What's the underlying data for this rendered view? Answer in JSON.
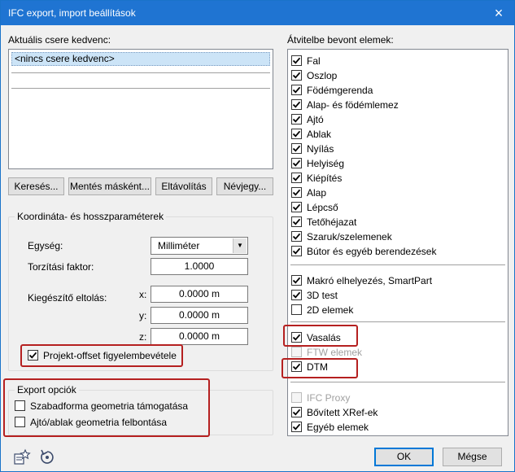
{
  "window": {
    "title": "IFC export, import beállítások",
    "close_icon": "×"
  },
  "favorites": {
    "label": "Aktuális csere kedvenc:",
    "items": [
      "<nincs csere kedvenc>"
    ]
  },
  "fav_buttons": {
    "search": "Keresés...",
    "save_as": "Mentés másként...",
    "remove": "Eltávolítás",
    "info": "Névjegy..."
  },
  "coords": {
    "group_title": "Koordináta- és hosszparaméterek",
    "unit_label": "Egység:",
    "unit_value": "Milliméter",
    "distortion_label": "Torzítási faktor:",
    "distortion_value": "1.0000",
    "offset_label": "Kiegészítő eltolás:",
    "x_label": "x:",
    "x_value": "0.0000 m",
    "y_label": "y:",
    "y_value": "0.0000 m",
    "z_label": "z:",
    "z_value": "0.0000 m",
    "project_offset_label": "Projekt-offset figyelembevétele",
    "project_offset_checked": true
  },
  "export_options": {
    "group_title": "Export opciók",
    "items": [
      {
        "label": "Szabadforma geometria támogatása",
        "checked": false
      },
      {
        "label": "Ajtó/ablak geometria felbontása",
        "checked": false
      }
    ]
  },
  "elements": {
    "label": "Átvitelbe bevont elemek:",
    "group1": [
      {
        "label": "Fal",
        "checked": true
      },
      {
        "label": "Oszlop",
        "checked": true
      },
      {
        "label": "Födémgerenda",
        "checked": true
      },
      {
        "label": "Alap- és födémlemez",
        "checked": true
      },
      {
        "label": "Ajtó",
        "checked": true
      },
      {
        "label": "Ablak",
        "checked": true
      },
      {
        "label": "Nyílás",
        "checked": true
      },
      {
        "label": "Helyiség",
        "checked": true
      },
      {
        "label": "Kiépítés",
        "checked": true
      },
      {
        "label": "Alap",
        "checked": true
      },
      {
        "label": "Lépcső",
        "checked": true
      },
      {
        "label": "Tetőhéjazat",
        "checked": true
      },
      {
        "label": "Szaruk/szelemenek",
        "checked": true
      },
      {
        "label": "Bútor és egyéb berendezések",
        "checked": true
      }
    ],
    "group2": [
      {
        "label": "Makró elhelyezés, SmartPart",
        "checked": true
      },
      {
        "label": "3D test",
        "checked": true
      },
      {
        "label": "2D elemek",
        "checked": false
      }
    ],
    "group3": [
      {
        "label": "Vasalás",
        "checked": true,
        "disabled": false
      },
      {
        "label": "FTW elemek",
        "checked": false,
        "disabled": true
      },
      {
        "label": "DTM",
        "checked": true,
        "disabled": false
      }
    ],
    "group4": [
      {
        "label": "IFC Proxy",
        "checked": false,
        "disabled": true
      },
      {
        "label": "Bővített XRef-ek",
        "checked": true,
        "disabled": false
      },
      {
        "label": "Egyéb elemek",
        "checked": true,
        "disabled": false
      }
    ]
  },
  "footer": {
    "ok": "OK",
    "cancel": "Mégse"
  },
  "colors": {
    "title_bar": "#1f74d2",
    "highlight_box": "#b52020",
    "selection": "#cce4f7"
  }
}
